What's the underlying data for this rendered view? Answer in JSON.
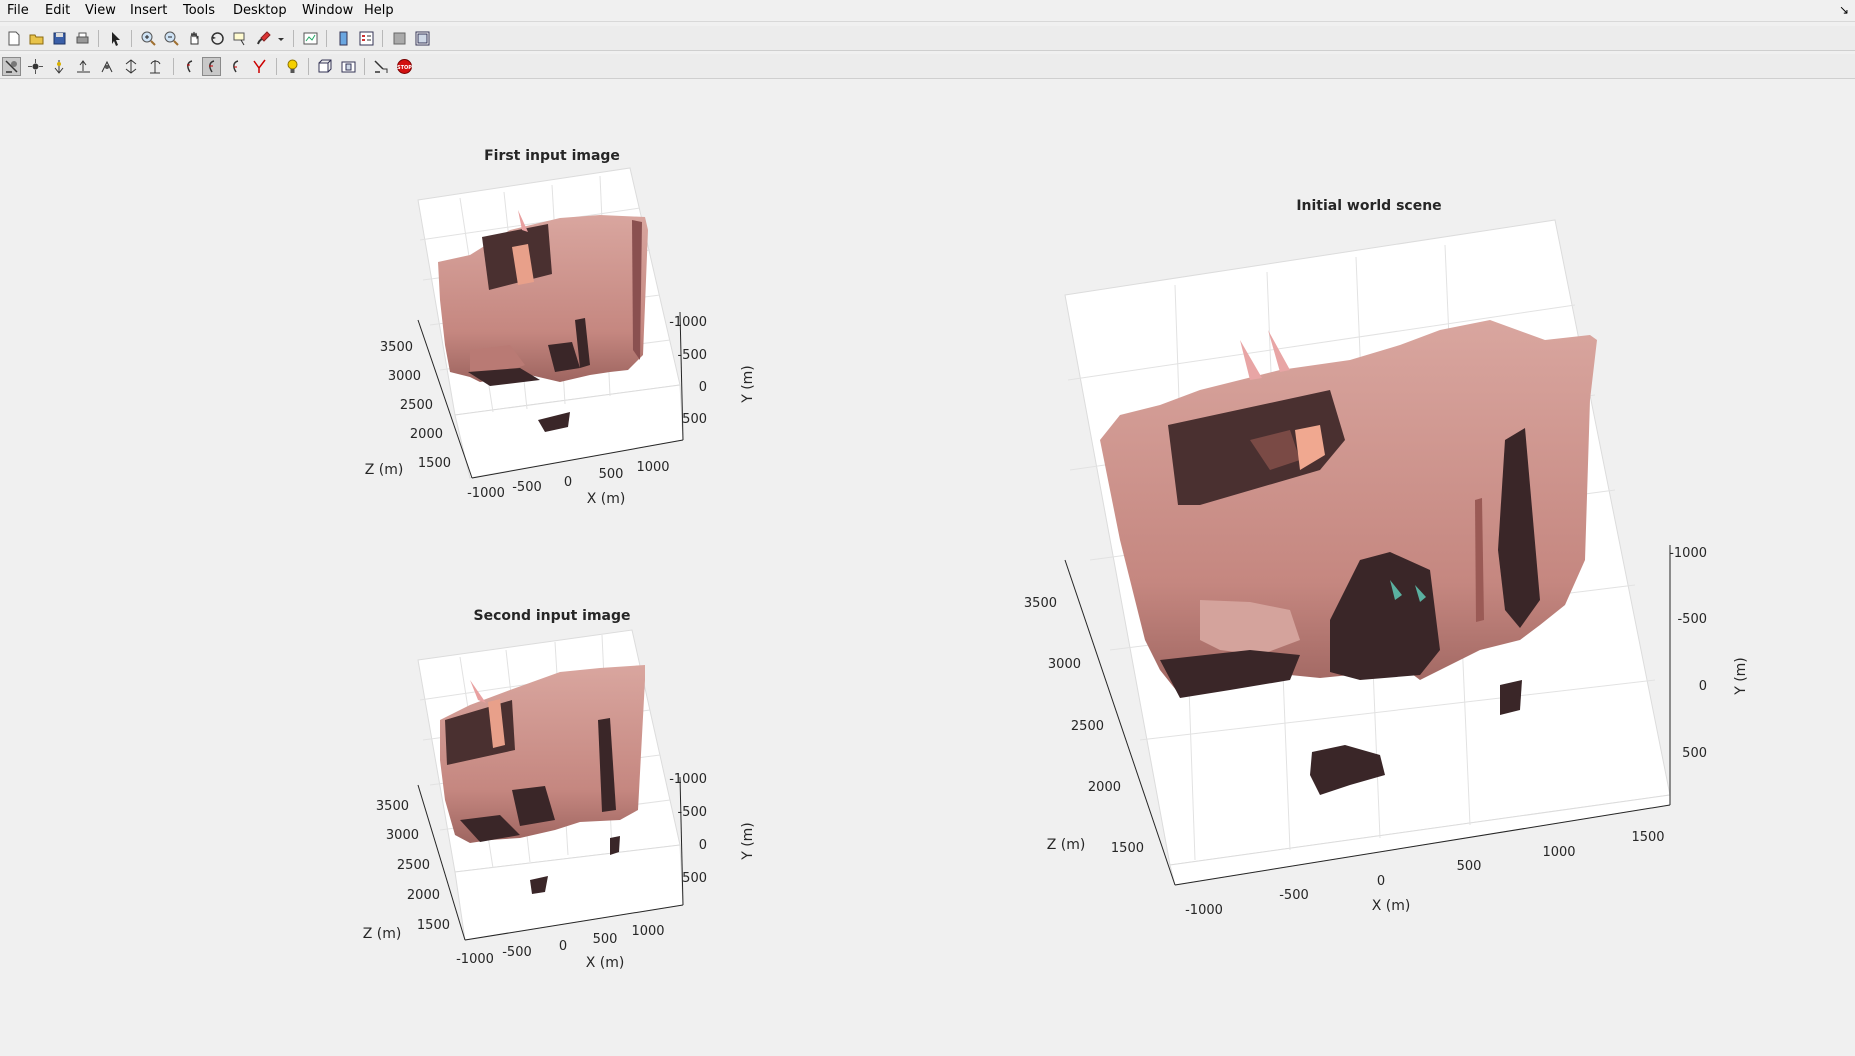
{
  "menu": [
    "File",
    "Edit",
    "View",
    "Insert",
    "Tools",
    "Desktop",
    "Window",
    "Help"
  ],
  "toolbar1_icons": [
    "new-figure-icon",
    "open-file-icon",
    "save-figure-icon",
    "print-figure-icon",
    "edit-plot-icon",
    "zoom-in-icon",
    "zoom-out-icon",
    "pan-icon",
    "rotate-3d-icon",
    "data-cursor-icon",
    "brush-icon",
    "brush-dropdown-icon",
    "link-plot-icon",
    "insert-colorbar-icon",
    "insert-legend-icon",
    "hide-plot-tools-icon",
    "show-plot-tools-icon"
  ],
  "toolbar2_icons": [
    "camera-orbit-icon",
    "camera-orbit-scene-light-icon",
    "camera-pan-tilt-icon",
    "camera-move-horizontal-icon",
    "camera-move-forward-icon",
    "camera-zoom-icon",
    "camera-roll-icon",
    "principal-axis-x-icon",
    "principal-axis-y-icon",
    "principal-axis-z-icon",
    "scene-light-icon",
    "orthographic-projection-icon",
    "perspective-projection-icon",
    "reset-camera-icon",
    "stop-camera-icon"
  ],
  "colors": {
    "cloud": "#c98880",
    "cloud_dark": "#a8665f",
    "shadow": "#3a2628",
    "grid": "#e2e2e2",
    "axis": "#262626"
  },
  "plots": [
    {
      "title": "First input image",
      "xlabel": "X (m)",
      "ylabel": "Y (m)",
      "zlabel": "Z (m)",
      "xticks": [
        "-1000",
        "-500",
        "0",
        "500",
        "1000"
      ],
      "yticks": [
        "-1000",
        "-500",
        "0",
        "500"
      ],
      "zticks": [
        "3500",
        "3000",
        "2500",
        "2000",
        "1500"
      ]
    },
    {
      "title": "Second input image",
      "xlabel": "X (m)",
      "ylabel": "Y (m)",
      "zlabel": "Z (m)",
      "xticks": [
        "-1000",
        "-500",
        "0",
        "500",
        "1000"
      ],
      "yticks": [
        "-1000",
        "-500",
        "0",
        "500"
      ],
      "zticks": [
        "3500",
        "3000",
        "2500",
        "2000",
        "1500"
      ]
    },
    {
      "title": "Initial world scene",
      "xlabel": "X (m)",
      "ylabel": "Y (m)",
      "zlabel": "Z (m)",
      "xticks": [
        "-1000",
        "-500",
        "0",
        "500",
        "1000",
        "1500"
      ],
      "yticks": [
        "-1000",
        "-500",
        "0",
        "500"
      ],
      "zticks": [
        "3500",
        "3000",
        "2500",
        "2000",
        "1500"
      ]
    }
  ]
}
